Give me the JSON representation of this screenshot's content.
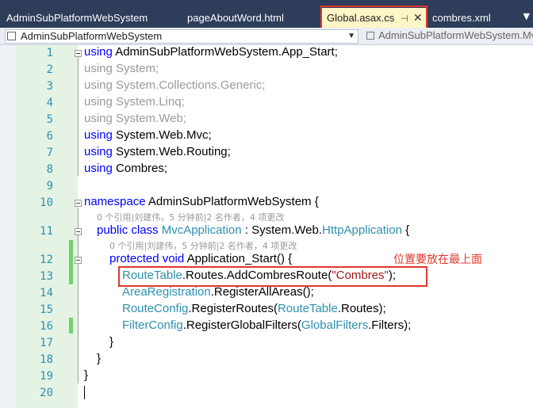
{
  "tabs": [
    {
      "label": "AdminSubPlatformWebSystem"
    },
    {
      "label": "pageAboutWord.html"
    },
    {
      "label": "Global.asax.cs",
      "pin": "⊣",
      "close": "✕"
    },
    {
      "label": "combres.xml"
    }
  ],
  "tab_overflow": "▼",
  "nav": {
    "project": "AdminSubPlatformWebSystem",
    "dropdown": "▼",
    "member": "AdminSubPlatformWebSystem.Mv"
  },
  "line_numbers": [
    "1",
    "2",
    "3",
    "4",
    "5",
    "6",
    "7",
    "8",
    "9",
    "10",
    "11",
    "12",
    "13",
    "14",
    "15",
    "16",
    "17",
    "18",
    "19",
    "20"
  ],
  "code": {
    "l1": {
      "kw": "using",
      "rest": " AdminSubPlatformWebSystem.App_Start;"
    },
    "l2": {
      "kw": "using",
      "rest": " System;"
    },
    "l3": {
      "kw": "using",
      "rest": " System.Collections.Generic;"
    },
    "l4": {
      "kw": "using",
      "rest": " System.Linq;"
    },
    "l5": {
      "kw": "using",
      "rest": " System.Web;"
    },
    "l6": {
      "kw": "using",
      "rest": " System.Web.Mvc;"
    },
    "l7": {
      "kw": "using",
      "rest": " System.Web.Routing;"
    },
    "l8": {
      "kw": "using",
      "rest": " Combres;"
    },
    "l10": {
      "kw": "namespace",
      "rest": " AdminSubPlatformWebSystem {"
    },
    "l11": {
      "kw1": "public",
      "kw2": " class ",
      "type": "MvcApplication",
      "mid": " : System.Web.",
      "type2": "HttpApplication",
      "end": " {"
    },
    "l12": {
      "kw1": "protected",
      "kw2": " void",
      "rest": " Application_Start() {"
    },
    "l13": {
      "type": "RouteTable",
      "mid": ".Routes.AddCombresRoute(",
      "str": "\"Combres\"",
      "end": ");"
    },
    "l14": {
      "type": "AreaRegistration",
      "rest": ".RegisterAllAreas();"
    },
    "l15": {
      "type": "RouteConfig",
      "mid": ".RegisterRoutes(",
      "type2": "RouteTable",
      "end": ".Routes);"
    },
    "l16": {
      "type": "FilterConfig",
      "mid": ".RegisterGlobalFilters(",
      "type2": "GlobalFilters",
      "end": ".Filters);"
    },
    "l17": {
      "text": "}"
    },
    "l18": {
      "text": "}"
    },
    "l19": {
      "text": "}"
    }
  },
  "codelens": {
    "ns": "0 个引用|刘建伟，5 分钟前|2 名作者，4 项更改",
    "cls": "0 个引用|刘建伟，5 分钟前|2 名作者，4 项更改"
  },
  "annotation": "位置要放在最上面",
  "colors": {
    "tab_bar": "#2d3d5a",
    "active_tab": "#fff6c8",
    "keyword": "#0000ff",
    "type": "#2b91af",
    "string": "#a31515",
    "highlight": "#e0372c",
    "gutter": "#e5f3e5",
    "change_marker": "#6fd36f"
  }
}
